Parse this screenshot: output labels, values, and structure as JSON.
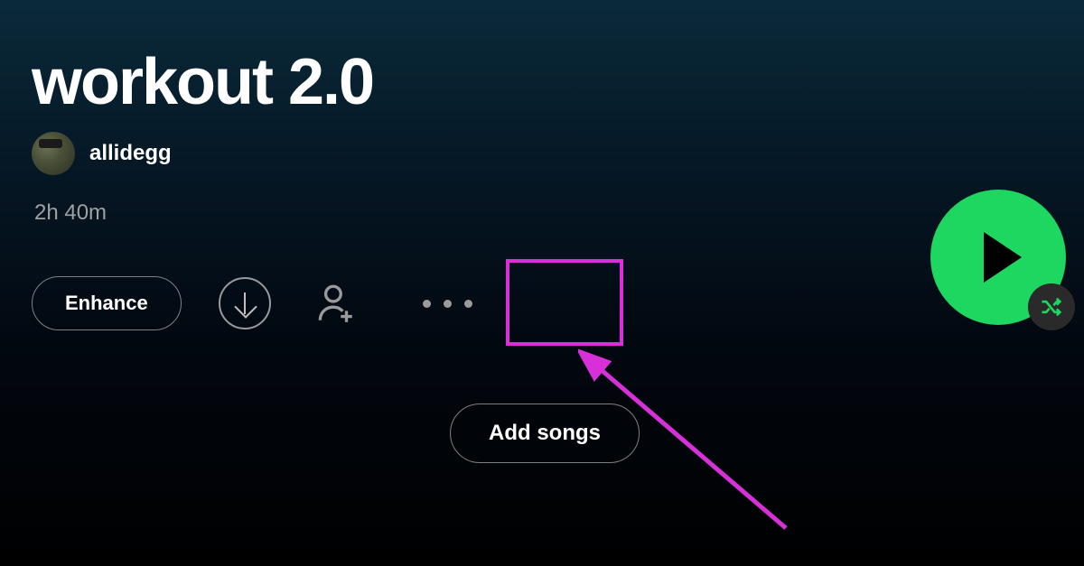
{
  "playlist": {
    "title": "workout 2.0",
    "owner": "allidegg",
    "duration": "2h 40m"
  },
  "actions": {
    "enhance_label": "Enhance",
    "add_songs_label": "Add songs"
  },
  "colors": {
    "accent": "#1ed760",
    "annotation": "#d830d8"
  }
}
